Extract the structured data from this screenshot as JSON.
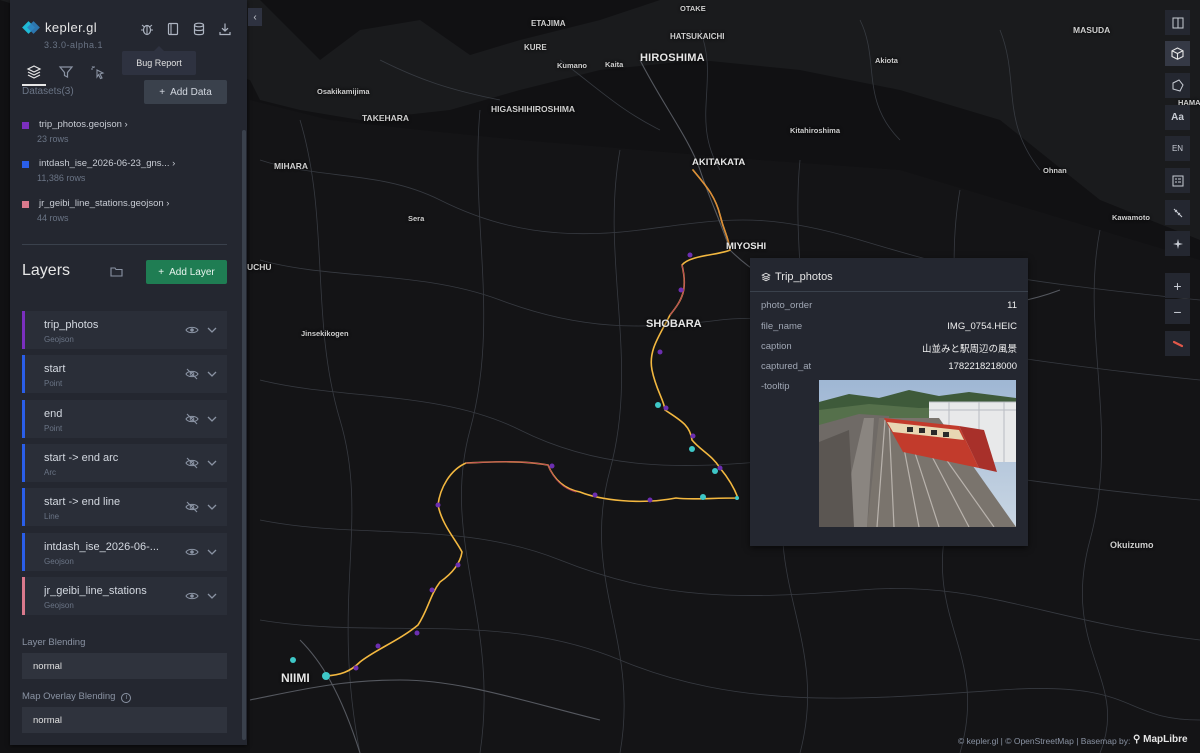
{
  "app": {
    "name": "kepler.gl",
    "version": "3.3.0-alpha.1",
    "tooltip": "Bug Report",
    "collapse_glyph": "‹"
  },
  "datasets": {
    "heading": "Datasets(3)",
    "add_label": "Add Data",
    "items": [
      {
        "name": "trip_photos.geojson",
        "rows": "23 rows",
        "color": "#7b2fbe"
      },
      {
        "name": "intdash_ise_2026-06-23_gns...",
        "rows": "11,386 rows",
        "color": "#2a5ee8"
      },
      {
        "name": "jr_geibi_line_stations.geojson",
        "rows": "44 rows",
        "color": "#d9798c"
      }
    ]
  },
  "layers": {
    "heading": "Layers",
    "add_label": "Add Layer",
    "items": [
      {
        "name": "trip_photos",
        "type": "Geojson",
        "color": "#7b2fbe",
        "visible": true
      },
      {
        "name": "start",
        "type": "Point",
        "color": "#2a5ee8",
        "visible": false
      },
      {
        "name": "end",
        "type": "Point",
        "color": "#2a5ee8",
        "visible": false
      },
      {
        "name": "start -> end arc",
        "type": "Arc",
        "color": "#2a5ee8",
        "visible": false
      },
      {
        "name": "start -> end line",
        "type": "Line",
        "color": "#2a5ee8",
        "visible": false
      },
      {
        "name": "intdash_ise_2026-06-...",
        "type": "Geojson",
        "color": "#2a5ee8",
        "visible": true
      },
      {
        "name": "jr_geibi_line_stations",
        "type": "Geojson",
        "color": "#d9798c",
        "visible": true
      }
    ]
  },
  "blending": {
    "layer_label": "Layer Blending",
    "layer_value": "normal",
    "overlay_label": "Map Overlay Blending",
    "overlay_value": "normal"
  },
  "toolbar": {
    "locale": "EN",
    "font": "Aa",
    "zoom_in": "+",
    "zoom_out": "−"
  },
  "popup": {
    "title": "Trip_photos",
    "rows": [
      {
        "key": "photo_order",
        "value": "11"
      },
      {
        "key": "file_name",
        "value": "IMG_0754.HEIC"
      },
      {
        "key": "caption",
        "value": "山並みと駅周辺の風景"
      },
      {
        "key": "captured_at",
        "value": "1782218218000"
      }
    ],
    "tooltip_key": "-tooltip"
  },
  "map_labels": [
    "OTAKE",
    "ETAJIMA",
    "HATSUKAICHI",
    "KURE",
    "HIROSHIMA",
    "MASUDA",
    "Kumano",
    "Kaita",
    "Akiota",
    "Osakikamijima",
    "HIGASHIHIROSHIMA",
    "TAKEHARA",
    "Kitahiroshima",
    "MIHARA",
    "AKITAKATA",
    "Ohnan",
    "Sera",
    "Kawamoto",
    "MIYOSHI",
    "UCHU",
    "SHOBARA",
    "Jinsekikogen",
    "Okuizumo",
    "NIIMI",
    "HAMA"
  ],
  "attribution": {
    "text": "© kepler.gl | © OpenStreetMap | Basemap by:",
    "brand": "MapLibre"
  }
}
